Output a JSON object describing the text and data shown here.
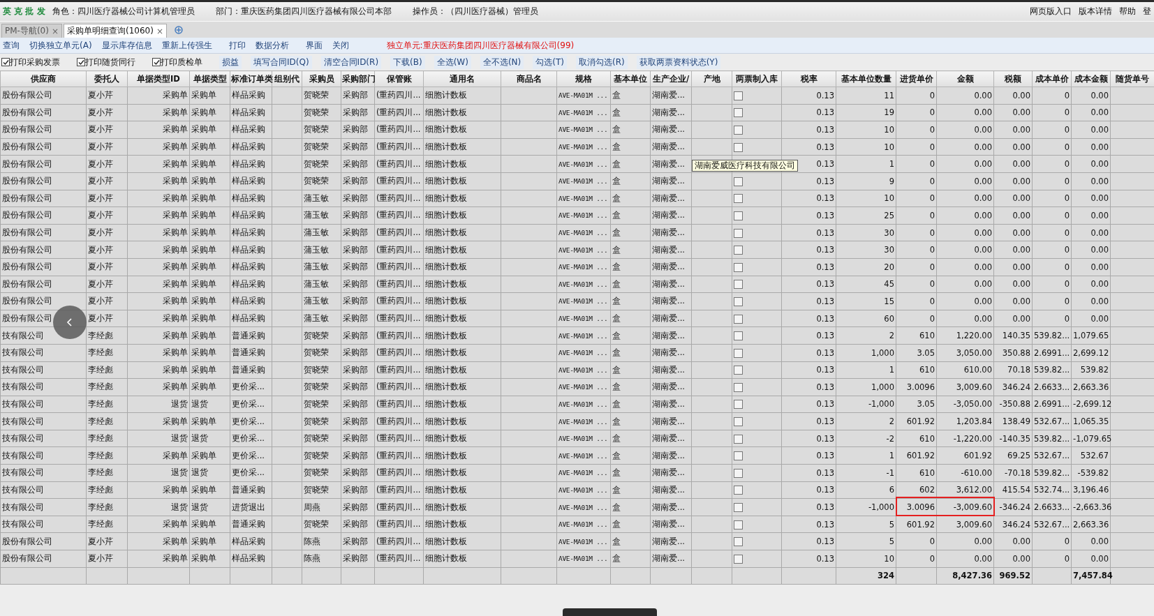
{
  "header": {
    "logo": "英 克 批 发",
    "role": "角色：四川医疗器械公司计算机管理员",
    "department": "部门：重庆医药集团四川医疗器械有限公司本部",
    "operator": "操作员：（四川医疗器械）管理员",
    "links": [
      "网页版入口",
      "版本详情",
      "帮助",
      "登"
    ]
  },
  "tabs": [
    {
      "label": "PM-导航(0)",
      "selected": false,
      "close": "×"
    },
    {
      "label": "采购单明细查询(1060)",
      "selected": true,
      "close": "×"
    }
  ],
  "toolbar": {
    "actions": [
      "查询",
      "切换独立单元(A)",
      "显示库存信息",
      "重新上传强生",
      "打印",
      "数据分析",
      "界面",
      "关闭"
    ],
    "unit_notice": "独立单元:重庆医药集团四川医疗器械有限公司(99)"
  },
  "options": {
    "checkboxes": [
      {
        "label": "打印采购发票",
        "checked": true
      },
      {
        "label": "打印随货同行",
        "checked": true
      },
      {
        "label": "打印质检单",
        "checked": true
      }
    ],
    "actions": [
      "损益",
      "填写合同ID(Q)",
      "清空合同ID(R)",
      "下载(B)",
      "全选(W)",
      "全不选(N)",
      "勾选(T)",
      "取消勾选(R)",
      "获取两票资料状态(Y)"
    ]
  },
  "table": {
    "columns": [
      "供应商",
      "委托人",
      "单据类型ID",
      "单据类型",
      "标准订单类",
      "组别代",
      "采购员",
      "采购部门",
      "保管账",
      "通用名",
      "商品名",
      "规格",
      "基本单位",
      "生产企业/",
      "产地",
      "两票制入库",
      "税率",
      "基本单位数量",
      "进货单价",
      "金额",
      "税额",
      "成本单价",
      "成本金额",
      "随货单号"
    ],
    "rows": [
      {
        "supplier": "股份有限公司",
        "client": "夏小芹",
        "doc_type_id": "采购单",
        "doc_type": "采购单",
        "order_type": "样品采购",
        "buyer": "贺晓荣",
        "dept": "采购部",
        "ledger": "(重药四川...",
        "generic_name": "细胞计数板",
        "spec": "AVE-MA01M ...",
        "unit": "盒",
        "maker": "湖南爱...",
        "two_ticket": false,
        "tax_rate": "0.13",
        "qty": "11",
        "price": "0",
        "amount": "0.00",
        "tax": "0.00",
        "cost_price": "0",
        "cost_amount": "0.00"
      },
      {
        "supplier": "股份有限公司",
        "client": "夏小芹",
        "doc_type_id": "采购单",
        "doc_type": "采购单",
        "order_type": "样品采购",
        "buyer": "贺晓荣",
        "dept": "采购部",
        "ledger": "(重药四川...",
        "generic_name": "细胞计数板",
        "spec": "AVE-MA01M ...",
        "unit": "盒",
        "maker": "湖南爱...",
        "two_ticket": false,
        "tax_rate": "0.13",
        "qty": "19",
        "price": "0",
        "amount": "0.00",
        "tax": "0.00",
        "cost_price": "0",
        "cost_amount": "0.00"
      },
      {
        "supplier": "股份有限公司",
        "client": "夏小芹",
        "doc_type_id": "采购单",
        "doc_type": "采购单",
        "order_type": "样品采购",
        "buyer": "贺晓荣",
        "dept": "采购部",
        "ledger": "(重药四川...",
        "generic_name": "细胞计数板",
        "spec": "AVE-MA01M ...",
        "unit": "盒",
        "maker": "湖南爱...",
        "two_ticket": false,
        "tax_rate": "0.13",
        "qty": "10",
        "price": "0",
        "amount": "0.00",
        "tax": "0.00",
        "cost_price": "0",
        "cost_amount": "0.00"
      },
      {
        "supplier": "股份有限公司",
        "client": "夏小芹",
        "doc_type_id": "采购单",
        "doc_type": "采购单",
        "order_type": "样品采购",
        "buyer": "贺晓荣",
        "dept": "采购部",
        "ledger": "(重药四川...",
        "generic_name": "细胞计数板",
        "spec": "AVE-MA01M ...",
        "unit": "盒",
        "maker": "湖南爱...",
        "two_ticket": false,
        "tax_rate": "0.13",
        "qty": "10",
        "price": "0",
        "amount": "0.00",
        "tax": "0.00",
        "cost_price": "0",
        "cost_amount": "0.00"
      },
      {
        "supplier": "股份有限公司",
        "client": "夏小芹",
        "doc_type_id": "采购单",
        "doc_type": "采购单",
        "order_type": "样品采购",
        "buyer": "贺晓荣",
        "dept": "采购部",
        "ledger": "(重药四川...",
        "generic_name": "细胞计数板",
        "spec": "AVE-MA01M ...",
        "unit": "盒",
        "maker": "湖南爱...",
        "tooltip": "湖南爱威医疗科技有限公司",
        "tax_rate": "0.13",
        "qty": "1",
        "price": "0",
        "amount": "0.00",
        "tax": "0.00",
        "cost_price": "0",
        "cost_amount": "0.00"
      },
      {
        "supplier": "股份有限公司",
        "client": "夏小芹",
        "doc_type_id": "采购单",
        "doc_type": "采购单",
        "order_type": "样品采购",
        "buyer": "贺晓荣",
        "dept": "采购部",
        "ledger": "(重药四川...",
        "generic_name": "细胞计数板",
        "spec": "AVE-MA01M ...",
        "unit": "盒",
        "maker": "湖南爱...",
        "two_ticket": false,
        "tax_rate": "0.13",
        "qty": "9",
        "price": "0",
        "amount": "0.00",
        "tax": "0.00",
        "cost_price": "0",
        "cost_amount": "0.00"
      },
      {
        "supplier": "股份有限公司",
        "client": "夏小芹",
        "doc_type_id": "采购单",
        "doc_type": "采购单",
        "order_type": "样品采购",
        "buyer": "蒲玉敏",
        "dept": "采购部",
        "ledger": "(重药四川...",
        "generic_name": "细胞计数板",
        "spec": "AVE-MA01M ...",
        "unit": "盒",
        "maker": "湖南爱...",
        "two_ticket": false,
        "tax_rate": "0.13",
        "qty": "10",
        "price": "0",
        "amount": "0.00",
        "tax": "0.00",
        "cost_price": "0",
        "cost_amount": "0.00"
      },
      {
        "supplier": "股份有限公司",
        "client": "夏小芹",
        "doc_type_id": "采购单",
        "doc_type": "采购单",
        "order_type": "样品采购",
        "buyer": "蒲玉敏",
        "dept": "采购部",
        "ledger": "(重药四川...",
        "generic_name": "细胞计数板",
        "spec": "AVE-MA01M ...",
        "unit": "盒",
        "maker": "湖南爱...",
        "two_ticket": false,
        "tax_rate": "0.13",
        "qty": "25",
        "price": "0",
        "amount": "0.00",
        "tax": "0.00",
        "cost_price": "0",
        "cost_amount": "0.00"
      },
      {
        "supplier": "股份有限公司",
        "client": "夏小芹",
        "doc_type_id": "采购单",
        "doc_type": "采购单",
        "order_type": "样品采购",
        "buyer": "蒲玉敏",
        "dept": "采购部",
        "ledger": "(重药四川...",
        "generic_name": "细胞计数板",
        "spec": "AVE-MA01M ...",
        "unit": "盒",
        "maker": "湖南爱...",
        "two_ticket": false,
        "tax_rate": "0.13",
        "qty": "30",
        "price": "0",
        "amount": "0.00",
        "tax": "0.00",
        "cost_price": "0",
        "cost_amount": "0.00"
      },
      {
        "supplier": "股份有限公司",
        "client": "夏小芹",
        "doc_type_id": "采购单",
        "doc_type": "采购单",
        "order_type": "样品采购",
        "buyer": "蒲玉敏",
        "dept": "采购部",
        "ledger": "(重药四川...",
        "generic_name": "细胞计数板",
        "spec": "AVE-MA01M ...",
        "unit": "盒",
        "maker": "湖南爱...",
        "two_ticket": false,
        "tax_rate": "0.13",
        "qty": "30",
        "price": "0",
        "amount": "0.00",
        "tax": "0.00",
        "cost_price": "0",
        "cost_amount": "0.00"
      },
      {
        "supplier": "股份有限公司",
        "client": "夏小芹",
        "doc_type_id": "采购单",
        "doc_type": "采购单",
        "order_type": "样品采购",
        "buyer": "蒲玉敏",
        "dept": "采购部",
        "ledger": "(重药四川...",
        "generic_name": "细胞计数板",
        "spec": "AVE-MA01M ...",
        "unit": "盒",
        "maker": "湖南爱...",
        "two_ticket": false,
        "tax_rate": "0.13",
        "qty": "20",
        "price": "0",
        "amount": "0.00",
        "tax": "0.00",
        "cost_price": "0",
        "cost_amount": "0.00"
      },
      {
        "supplier": "股份有限公司",
        "client": "夏小芹",
        "doc_type_id": "采购单",
        "doc_type": "采购单",
        "order_type": "样品采购",
        "buyer": "蒲玉敏",
        "dept": "采购部",
        "ledger": "(重药四川...",
        "generic_name": "细胞计数板",
        "spec": "AVE-MA01M ...",
        "unit": "盒",
        "maker": "湖南爱...",
        "two_ticket": false,
        "tax_rate": "0.13",
        "qty": "45",
        "price": "0",
        "amount": "0.00",
        "tax": "0.00",
        "cost_price": "0",
        "cost_amount": "0.00"
      },
      {
        "supplier": "股份有限公司",
        "client": "夏小芹",
        "doc_type_id": "采购单",
        "doc_type": "采购单",
        "order_type": "样品采购",
        "buyer": "蒲玉敏",
        "dept": "采购部",
        "ledger": "(重药四川...",
        "generic_name": "细胞计数板",
        "spec": "AVE-MA01M ...",
        "unit": "盒",
        "maker": "湖南爱...",
        "two_ticket": false,
        "tax_rate": "0.13",
        "qty": "15",
        "price": "0",
        "amount": "0.00",
        "tax": "0.00",
        "cost_price": "0",
        "cost_amount": "0.00"
      },
      {
        "supplier": "股份有限公司",
        "client": "夏小芹",
        "doc_type_id": "采购单",
        "doc_type": "采购单",
        "order_type": "样品采购",
        "buyer": "蒲玉敏",
        "dept": "采购部",
        "ledger": "(重药四川...",
        "generic_name": "细胞计数板",
        "spec": "AVE-MA01M ...",
        "unit": "盒",
        "maker": "湖南爱...",
        "two_ticket": false,
        "tax_rate": "0.13",
        "qty": "60",
        "price": "0",
        "amount": "0.00",
        "tax": "0.00",
        "cost_price": "0",
        "cost_amount": "0.00"
      },
      {
        "supplier": "技有限公司",
        "client": "李经彪",
        "doc_type_id": "采购单",
        "doc_type": "采购单",
        "order_type": "普通采购",
        "buyer": "贺晓荣",
        "dept": "采购部",
        "ledger": "(重药四川...",
        "generic_name": "细胞计数板",
        "spec": "AVE-MA01M ...",
        "unit": "盒",
        "maker": "湖南爱...",
        "two_ticket": false,
        "tax_rate": "0.13",
        "qty": "2",
        "price": "610",
        "amount": "1,220.00",
        "tax": "140.35",
        "cost_price": "539.82...",
        "cost_amount": "1,079.65"
      },
      {
        "supplier": "技有限公司",
        "client": "李经彪",
        "doc_type_id": "采购单",
        "doc_type": "采购单",
        "order_type": "普通采购",
        "buyer": "贺晓荣",
        "dept": "采购部",
        "ledger": "(重药四川...",
        "generic_name": "细胞计数板",
        "spec": "AVE-MA01M ...",
        "unit": "盒",
        "maker": "湖南爱...",
        "two_ticket": false,
        "tax_rate": "0.13",
        "qty": "1,000",
        "price": "3.05",
        "amount": "3,050.00",
        "tax": "350.88",
        "cost_price": "2.6991...",
        "cost_amount": "2,699.12"
      },
      {
        "supplier": "技有限公司",
        "client": "李经彪",
        "doc_type_id": "采购单",
        "doc_type": "采购单",
        "order_type": "普通采购",
        "buyer": "贺晓荣",
        "dept": "采购部",
        "ledger": "(重药四川...",
        "generic_name": "细胞计数板",
        "spec": "AVE-MA01M ...",
        "unit": "盒",
        "maker": "湖南爱...",
        "two_ticket": false,
        "tax_rate": "0.13",
        "qty": "1",
        "price": "610",
        "amount": "610.00",
        "tax": "70.18",
        "cost_price": "539.82...",
        "cost_amount": "539.82"
      },
      {
        "supplier": "技有限公司",
        "client": "李经彪",
        "doc_type_id": "采购单",
        "doc_type": "采购单",
        "order_type": "更价采...",
        "buyer": "贺晓荣",
        "dept": "采购部",
        "ledger": "(重药四川...",
        "generic_name": "细胞计数板",
        "spec": "AVE-MA01M ...",
        "unit": "盒",
        "maker": "湖南爱...",
        "two_ticket": false,
        "tax_rate": "0.13",
        "qty": "1,000",
        "price": "3.0096",
        "amount": "3,009.60",
        "tax": "346.24",
        "cost_price": "2.6633...",
        "cost_amount": "2,663.36"
      },
      {
        "supplier": "技有限公司",
        "client": "李经彪",
        "doc_type_id": "退货",
        "doc_type": "退货",
        "order_type": "更价采...",
        "buyer": "贺晓荣",
        "dept": "采购部",
        "ledger": "(重药四川...",
        "generic_name": "细胞计数板",
        "spec": "AVE-MA01M ...",
        "unit": "盒",
        "maker": "湖南爱...",
        "two_ticket": false,
        "tax_rate": "0.13",
        "qty": "-1,000",
        "price": "3.05",
        "amount": "-3,050.00",
        "tax": "-350.88",
        "cost_price": "2.6991...",
        "cost_amount": "-2,699.12"
      },
      {
        "supplier": "技有限公司",
        "client": "李经彪",
        "doc_type_id": "采购单",
        "doc_type": "采购单",
        "order_type": "更价采...",
        "buyer": "贺晓荣",
        "dept": "采购部",
        "ledger": "(重药四川...",
        "generic_name": "细胞计数板",
        "spec": "AVE-MA01M ...",
        "unit": "盒",
        "maker": "湖南爱...",
        "two_ticket": false,
        "tax_rate": "0.13",
        "qty": "2",
        "price": "601.92",
        "amount": "1,203.84",
        "tax": "138.49",
        "cost_price": "532.67...",
        "cost_amount": "1,065.35"
      },
      {
        "supplier": "技有限公司",
        "client": "李经彪",
        "doc_type_id": "退货",
        "doc_type": "退货",
        "order_type": "更价采...",
        "buyer": "贺晓荣",
        "dept": "采购部",
        "ledger": "(重药四川...",
        "generic_name": "细胞计数板",
        "spec": "AVE-MA01M ...",
        "unit": "盒",
        "maker": "湖南爱...",
        "two_ticket": false,
        "tax_rate": "0.13",
        "qty": "-2",
        "price": "610",
        "amount": "-1,220.00",
        "tax": "-140.35",
        "cost_price": "539.82...",
        "cost_amount": "-1,079.65"
      },
      {
        "supplier": "技有限公司",
        "client": "李经彪",
        "doc_type_id": "采购单",
        "doc_type": "采购单",
        "order_type": "更价采...",
        "buyer": "贺晓荣",
        "dept": "采购部",
        "ledger": "(重药四川...",
        "generic_name": "细胞计数板",
        "spec": "AVE-MA01M ...",
        "unit": "盒",
        "maker": "湖南爱...",
        "two_ticket": false,
        "tax_rate": "0.13",
        "qty": "1",
        "price": "601.92",
        "amount": "601.92",
        "tax": "69.25",
        "cost_price": "532.67...",
        "cost_amount": "532.67"
      },
      {
        "supplier": "技有限公司",
        "client": "李经彪",
        "doc_type_id": "退货",
        "doc_type": "退货",
        "order_type": "更价采...",
        "buyer": "贺晓荣",
        "dept": "采购部",
        "ledger": "(重药四川...",
        "generic_name": "细胞计数板",
        "spec": "AVE-MA01M ...",
        "unit": "盒",
        "maker": "湖南爱...",
        "two_ticket": false,
        "tax_rate": "0.13",
        "qty": "-1",
        "price": "610",
        "amount": "-610.00",
        "tax": "-70.18",
        "cost_price": "539.82...",
        "cost_amount": "-539.82"
      },
      {
        "supplier": "技有限公司",
        "client": "李经彪",
        "doc_type_id": "采购单",
        "doc_type": "采购单",
        "order_type": "普通采购",
        "buyer": "贺晓荣",
        "dept": "采购部",
        "ledger": "(重药四川...",
        "generic_name": "细胞计数板",
        "spec": "AVE-MA01M ...",
        "unit": "盒",
        "maker": "湖南爱...",
        "two_ticket": false,
        "tax_rate": "0.13",
        "qty": "6",
        "price": "602",
        "amount": "3,612.00",
        "tax": "415.54",
        "cost_price": "532.74...",
        "cost_amount": "3,196.46"
      },
      {
        "supplier": "技有限公司",
        "client": "李经彪",
        "doc_type_id": "退货",
        "doc_type": "退货",
        "order_type": "进货退出",
        "buyer": "周燕",
        "dept": "采购部",
        "ledger": "(重药四川...",
        "generic_name": "细胞计数板",
        "spec": "AVE-MA01M ...",
        "unit": "盒",
        "maker": "湖南爱...",
        "two_ticket": false,
        "tax_rate": "0.13",
        "qty": "-1,000",
        "price": "3.0096",
        "amount": "-3,009.60",
        "tax": "-346.24",
        "cost_price": "2.6633...",
        "cost_amount": "-2,663.36",
        "highlighted": true
      },
      {
        "supplier": "技有限公司",
        "client": "李经彪",
        "doc_type_id": "采购单",
        "doc_type": "采购单",
        "order_type": "普通采购",
        "buyer": "贺晓荣",
        "dept": "采购部",
        "ledger": "(重药四川...",
        "generic_name": "细胞计数板",
        "spec": "AVE-MA01M ...",
        "unit": "盒",
        "maker": "湖南爱...",
        "two_ticket": false,
        "tax_rate": "0.13",
        "qty": "5",
        "price": "601.92",
        "amount": "3,009.60",
        "tax": "346.24",
        "cost_price": "532.67...",
        "cost_amount": "2,663.36"
      },
      {
        "supplier": "股份有限公司",
        "client": "夏小芹",
        "doc_type_id": "采购单",
        "doc_type": "采购单",
        "order_type": "样品采购",
        "buyer": "陈燕",
        "dept": "采购部",
        "ledger": "(重药四川...",
        "generic_name": "细胞计数板",
        "spec": "AVE-MA01M ...",
        "unit": "盒",
        "maker": "湖南爱...",
        "two_ticket": false,
        "tax_rate": "0.13",
        "qty": "5",
        "price": "0",
        "amount": "0.00",
        "tax": "0.00",
        "cost_price": "0",
        "cost_amount": "0.00"
      },
      {
        "supplier": "股份有限公司",
        "client": "夏小芹",
        "doc_type_id": "采购单",
        "doc_type": "采购单",
        "order_type": "样品采购",
        "buyer": "陈燕",
        "dept": "采购部",
        "ledger": "(重药四川...",
        "generic_name": "细胞计数板",
        "spec": "AVE-MA01M ...",
        "unit": "盒",
        "maker": "湖南爱...",
        "two_ticket": false,
        "tax_rate": "0.13",
        "qty": "10",
        "price": "0",
        "amount": "0.00",
        "tax": "0.00",
        "cost_price": "0",
        "cost_amount": "0.00"
      }
    ],
    "totals": {
      "qty": "324",
      "amount": "8,427.36",
      "tax": "969.52",
      "cost_amount": "7,457.84"
    }
  }
}
